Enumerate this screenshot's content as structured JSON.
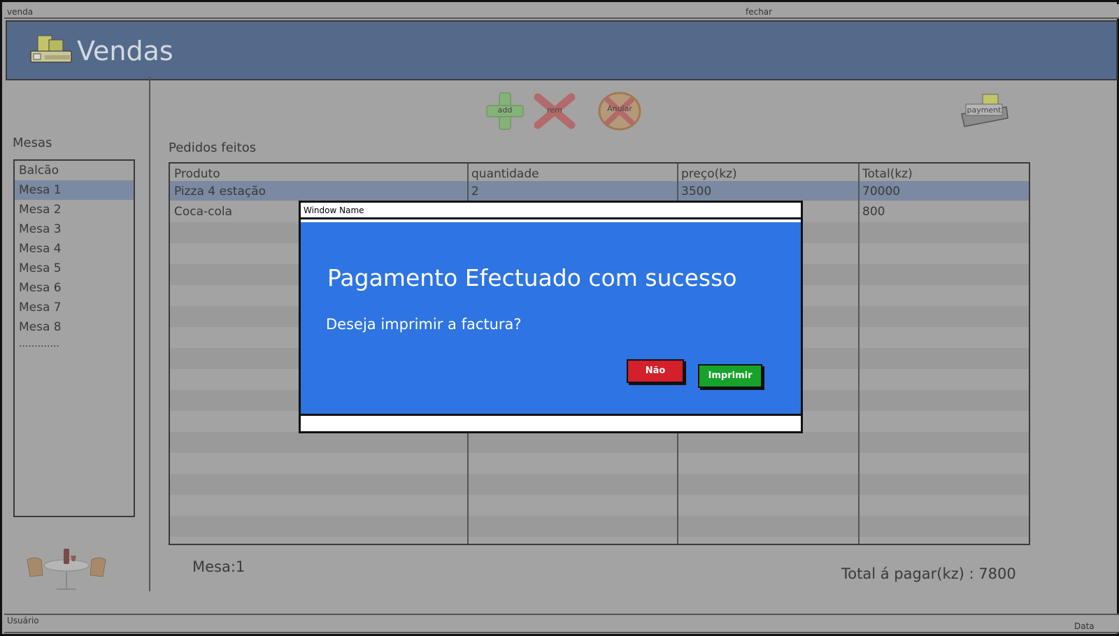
{
  "window": {
    "menu_left": "venda",
    "menu_right": "fechar"
  },
  "header": {
    "title": "Vendas"
  },
  "toolbar": {
    "add_label": "add",
    "rem_label": "rem",
    "anular_label": "Anular",
    "payment_label": "payment"
  },
  "sidebar": {
    "title": "Mesas",
    "items": [
      {
        "label": "Balcão"
      },
      {
        "label": "Mesa 1"
      },
      {
        "label": "Mesa 2"
      },
      {
        "label": "Mesa 3"
      },
      {
        "label": "Mesa 4"
      },
      {
        "label": "Mesa 5"
      },
      {
        "label": "Mesa 6"
      },
      {
        "label": "Mesa 7"
      },
      {
        "label": "Mesa 8"
      }
    ],
    "more": "............."
  },
  "orders": {
    "title": "Pedidos feitos",
    "columns": [
      "Produto",
      "quantidade",
      "preço(kz)",
      "Total(kz)"
    ],
    "rows": [
      [
        "Pizza 4 estação",
        "2",
        "3500",
        "70000"
      ],
      [
        "Coca-cola",
        "",
        "",
        "800"
      ]
    ]
  },
  "footer": {
    "mesa": "Mesa:1",
    "total": "Total á pagar(kz) : 7800"
  },
  "statusbar": {
    "left": "Usuário",
    "right": "Data"
  },
  "dialog": {
    "window_name": "Window Name",
    "headline": "Pagamento Efectuado com sucesso",
    "question": "Deseja imprimir a factura?",
    "no_label": "Não",
    "print_label": "Imprimir"
  },
  "colors": {
    "header": "#546a8b",
    "dialog_body": "#2e74e3",
    "button_no": "#d3202a",
    "button_print": "#17a22a",
    "selection": "#7b8aa2"
  }
}
